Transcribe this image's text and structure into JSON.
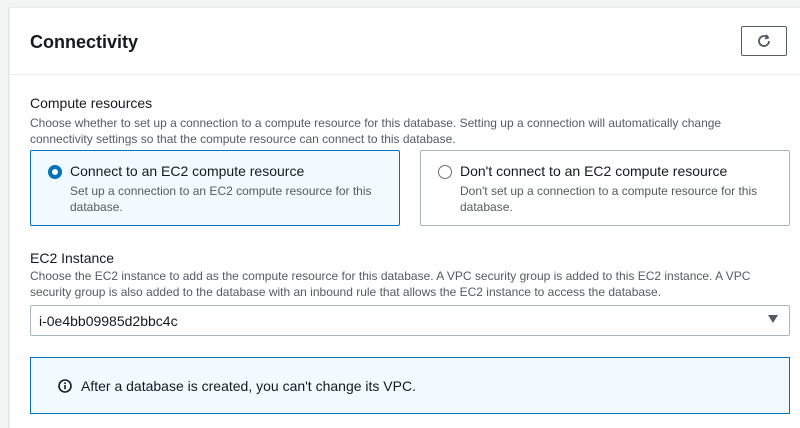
{
  "panel": {
    "title": "Connectivity",
    "refresh_icon": "refresh-icon"
  },
  "compute": {
    "label": "Compute resources",
    "description": "Choose whether to set up a connection to a compute resource for this database. Setting up a connection will automatically change connectivity settings so that the compute resource can connect to this database.",
    "options": [
      {
        "title": "Connect to an EC2 compute resource",
        "description": "Set up a connection to an EC2 compute resource for this database.",
        "selected": true
      },
      {
        "title": "Don't connect to an EC2 compute resource",
        "description": "Don't set up a connection to a compute resource for this database.",
        "selected": false
      }
    ]
  },
  "ec2": {
    "label": "EC2 Instance",
    "description": "Choose the EC2 instance to add as the compute resource for this database. A VPC security group is added to this EC2 instance. A VPC security group is also added to the database with an inbound rule that allows the EC2 instance to access the database.",
    "selected_value": "i-0e4bb09985d2bbc4c"
  },
  "alert": {
    "icon": "info-icon",
    "text": "After a database is created, you can't change its VPC."
  },
  "colors": {
    "accent": "#0073bb",
    "selected_bg": "#f1faff",
    "text": "#16191f",
    "muted_text": "#545b64"
  }
}
